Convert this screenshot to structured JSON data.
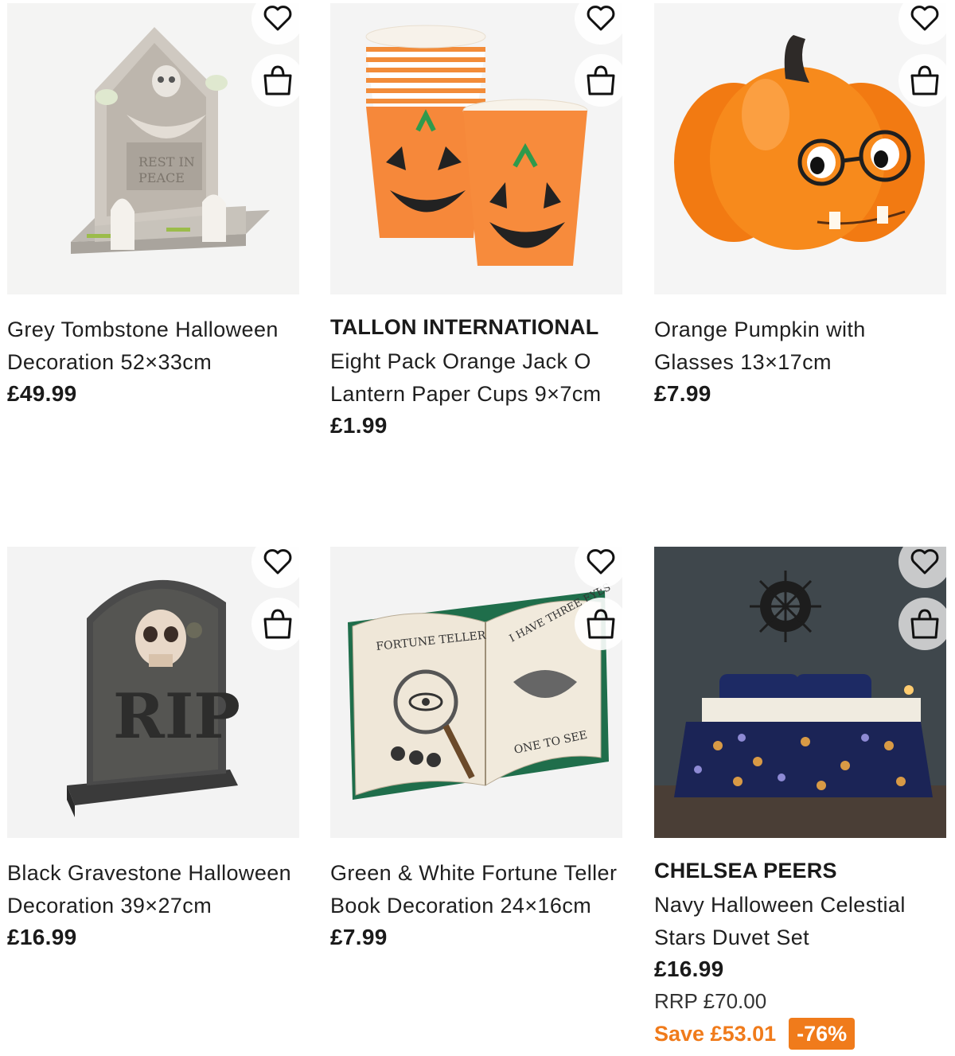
{
  "products": [
    {
      "title": "Grey Tombstone Halloween Decoration 52×33cm",
      "price": "£49.99",
      "image": "grey-tombstone",
      "wishlist_icon": "heart-outline-icon",
      "bag_icon": "shopping-bag-icon"
    },
    {
      "brand": "TALLON INTERNATIONAL",
      "title": "Eight Pack Orange Jack O Lantern Paper Cups 9×7cm",
      "price": "£1.99",
      "image": "pumpkin-paper-cups",
      "wishlist_icon": "heart-outline-icon",
      "bag_icon": "shopping-bag-icon"
    },
    {
      "title": "Orange Pumpkin with Glasses 13×17cm",
      "price": "£7.99",
      "image": "pumpkin-with-glasses",
      "wishlist_icon": "heart-outline-icon",
      "bag_icon": "shopping-bag-icon"
    },
    {
      "title": "Black Gravestone Halloween Decoration 39×27cm",
      "price": "£16.99",
      "image": "rip-gravestone",
      "wishlist_icon": "heart-outline-icon",
      "bag_icon": "shopping-bag-icon"
    },
    {
      "title": "Green & White Fortune Teller Book Decoration 24×16cm",
      "price": "£7.99",
      "image": "fortune-teller-book",
      "wishlist_icon": "heart-outline-icon",
      "bag_icon": "shopping-bag-icon"
    },
    {
      "brand": "CHELSEA PEERS",
      "title": "Navy Halloween Celestial Stars Duvet Set",
      "price": "£16.99",
      "rrp": "RRP £70.00",
      "save": "Save £53.01",
      "discount": "-76%",
      "image": "navy-duvet-bedroom",
      "wishlist_icon": "heart-outline-icon",
      "bag_icon": "shopping-bag-icon"
    }
  ],
  "book_image_text": {
    "left": "FORTUNE TELLER",
    "right": "I HAVE THREE EYES",
    "bottom": "ONE TO SEE"
  },
  "gravestone_text": "RIP",
  "colors": {
    "accent_orange": "#f07b1b",
    "text": "#1a1a1a",
    "image_bg": "#f3f3f3"
  }
}
